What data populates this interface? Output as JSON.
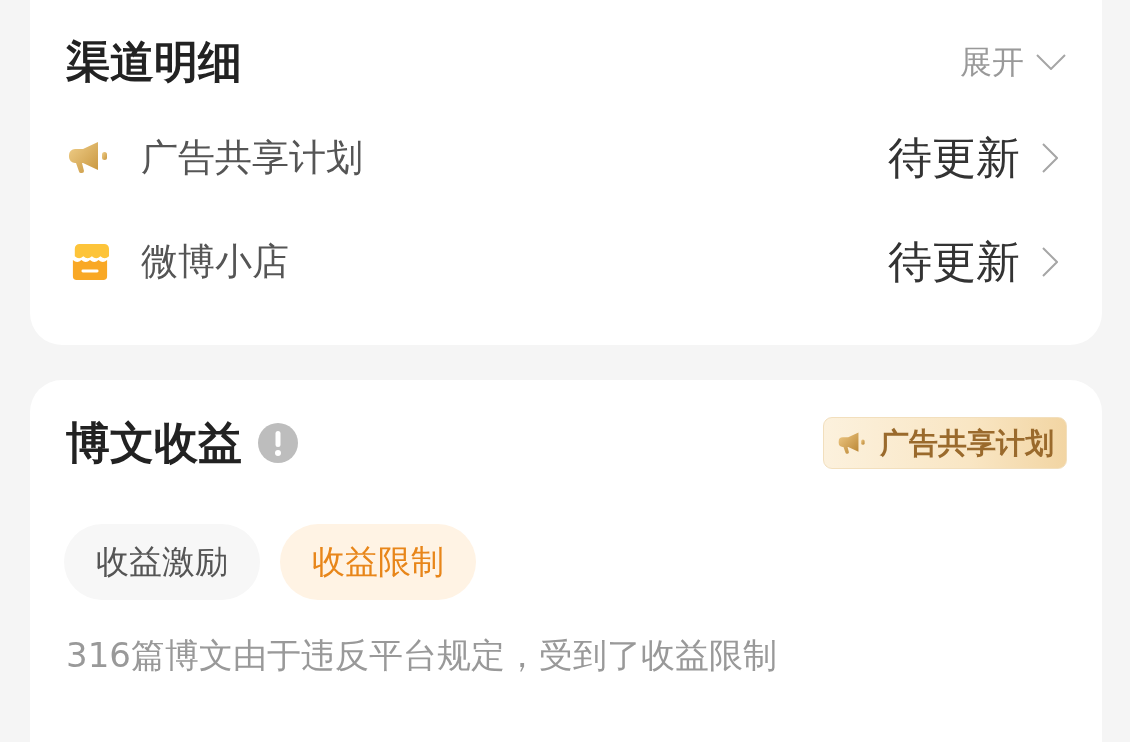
{
  "channel_details": {
    "title": "渠道明细",
    "expand": {
      "label": "展开",
      "expanded": false
    },
    "items": [
      {
        "kind": "megaphone",
        "label": "广告共享计划",
        "value": "待更新"
      },
      {
        "kind": "shop",
        "label": "微博小店",
        "value": "待更新"
      }
    ]
  },
  "post_earnings": {
    "title": "博文收益",
    "tag": "广告共享计划",
    "tabs": [
      {
        "label": "收益激励",
        "selected": false
      },
      {
        "label": "收益限制",
        "selected": true
      }
    ],
    "description": "316篇博文由于违反平台规定，受到了收益限制"
  }
}
